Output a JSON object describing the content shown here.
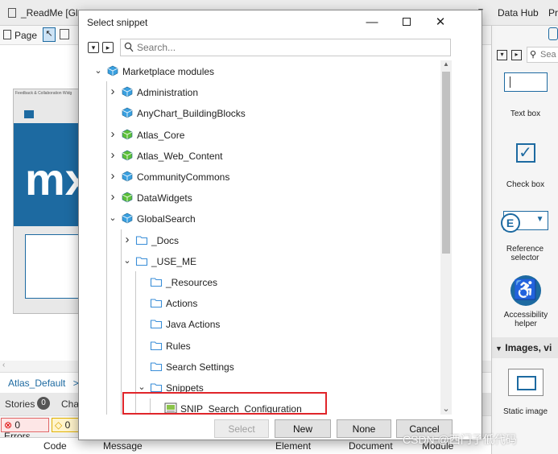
{
  "background": {
    "tabs": [
      "_ReadMe [Glo",
      "D"
    ],
    "data_hub_tab": "Data Hub",
    "pr_tab": "Pr",
    "page_button": "Page",
    "mode_suffix": "de",
    "widget_caption": "Feedback & Collaboration Widg",
    "breadcrumb": "Atlas_Default",
    "breadcrumb_sep": ">",
    "stories_label": "Stories",
    "stories_count": "0",
    "other_tab": "Char",
    "errors_label": "0 Errors",
    "deprecations_label": "0 D",
    "grid_headers": [
      "Code",
      "Message",
      "Element",
      "Document",
      "Module"
    ],
    "toolbox_search_placeholder": "Sea",
    "toolbox_items": [
      "Text box",
      "Check box",
      "Reference selector",
      "Accessibility helper",
      "Static image"
    ],
    "toolbox_section": "Images, vi"
  },
  "dialog": {
    "title": "Select snippet",
    "search_placeholder": "Search...",
    "tree": [
      {
        "label": "Marketplace modules",
        "icon": "blue-cube-icon",
        "chev": "down"
      },
      {
        "label": "Administration",
        "icon": "blue-cube-icon",
        "chev": "right"
      },
      {
        "label": "AnyChart_BuildingBlocks",
        "icon": "blue-cube-icon",
        "chev": "none"
      },
      {
        "label": "Atlas_Core",
        "icon": "green-cube-icon",
        "chev": "right"
      },
      {
        "label": "Atlas_Web_Content",
        "icon": "green-cube-icon",
        "chev": "right"
      },
      {
        "label": "CommunityCommons",
        "icon": "blue-cube-icon",
        "chev": "right"
      },
      {
        "label": "DataWidgets",
        "icon": "green-cube-icon",
        "chev": "right"
      },
      {
        "label": "GlobalSearch",
        "icon": "blue-cube-icon",
        "chev": "down"
      },
      {
        "label": "_Docs",
        "icon": "folder-icon",
        "chev": "right"
      },
      {
        "label": "_USE_ME",
        "icon": "folder-icon",
        "chev": "down"
      },
      {
        "label": "_Resources",
        "icon": "folder-icon",
        "chev": "none"
      },
      {
        "label": "Actions",
        "icon": "folder-icon",
        "chev": "none"
      },
      {
        "label": "Java Actions",
        "icon": "folder-icon",
        "chev": "none"
      },
      {
        "label": "Rules",
        "icon": "folder-icon",
        "chev": "none"
      },
      {
        "label": "Search Settings",
        "icon": "folder-icon",
        "chev": "none"
      },
      {
        "label": "Snippets",
        "icon": "folder-icon",
        "chev": "down"
      },
      {
        "label": "SNIP_Search_Configuration",
        "icon": "snippet-icon",
        "chev": "none"
      }
    ],
    "buttons": {
      "select": "Select",
      "new": "New",
      "none": "None",
      "cancel": "Cancel"
    }
  },
  "watermark": "CSDN @西门子低代码",
  "colors": {
    "highlight": "#e0252a",
    "accent": "#1d6aa1",
    "module_blue": "#3aa0e0",
    "module_green": "#5cbf3a",
    "folder": "#3a8ed8"
  }
}
